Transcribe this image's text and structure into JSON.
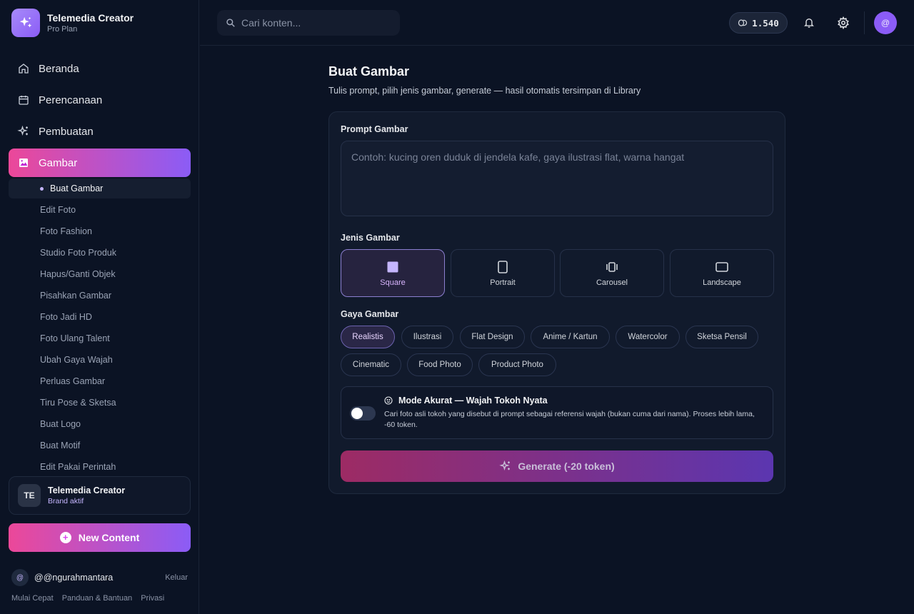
{
  "brand": {
    "title": "Telemedia Creator",
    "plan": "Pro Plan"
  },
  "nav": {
    "items": [
      {
        "label": "Beranda",
        "icon": "home-icon"
      },
      {
        "label": "Perencanaan",
        "icon": "calendar-icon"
      },
      {
        "label": "Pembuatan",
        "icon": "sparkles-icon"
      },
      {
        "label": "Gambar",
        "icon": "image-icon"
      }
    ],
    "sub_active": "Buat Gambar",
    "sub_items": [
      "Edit Foto",
      "Foto Fashion",
      "Studio Foto Produk",
      "Hapus/Ganti Objek",
      "Pisahkan Gambar",
      "Foto Jadi HD",
      "Foto Ulang Talent",
      "Ubah Gaya Wajah",
      "Perluas Gambar",
      "Tiru Pose & Sketsa",
      "Buat Logo",
      "Buat Motif",
      "Edit Pakai Perintah"
    ]
  },
  "brand_card": {
    "initials": "TE",
    "name": "Telemedia Creator",
    "status": "Brand aktif"
  },
  "new_content": {
    "label": "New Content"
  },
  "user": {
    "avatar": "@",
    "handle": "@@ngurahmantara",
    "logout": "Keluar"
  },
  "footer_links": [
    "Mulai Cepat",
    "Panduan & Bantuan",
    "Privasi"
  ],
  "topbar": {
    "search_placeholder": "Cari konten...",
    "tokens": "1.540",
    "avatar": "@"
  },
  "page": {
    "title": "Buat Gambar",
    "subtitle": "Tulis prompt, pilih jenis gambar, generate — hasil otomatis tersimpan di Library"
  },
  "form": {
    "prompt_label": "Prompt Gambar",
    "prompt_placeholder": "Contoh: kucing oren duduk di jendela kafe, gaya ilustrasi flat, warna hangat",
    "type_label": "Jenis Gambar",
    "types": [
      {
        "label": "Square",
        "icon": "square-icon",
        "selected": true
      },
      {
        "label": "Portrait",
        "icon": "portrait-icon",
        "selected": false
      },
      {
        "label": "Carousel",
        "icon": "carousel-icon",
        "selected": false
      },
      {
        "label": "Landscape",
        "icon": "landscape-icon",
        "selected": false
      }
    ],
    "style_label": "Gaya Gambar",
    "styles_row1": [
      "Realistis",
      "Ilustrasi",
      "Flat Design",
      "Anime / Kartun",
      "Watercolor",
      "Sketsa Pensil"
    ],
    "styles_row2": [
      "Cinematic",
      "Food Photo",
      "Product Photo"
    ],
    "selected_style": "Realistis",
    "mode_title": "Mode Akurat — Wajah Tokoh Nyata",
    "mode_desc": "Cari foto asli tokoh yang disebut di prompt sebagai referensi wajah (bukan cuma dari nama). Proses lebih lama, -60 token.",
    "mode_enabled": false,
    "generate_label": "Generate (-20 token)"
  },
  "colors": {
    "accent_pink": "#ec4899",
    "accent_purple": "#8b5cf6",
    "background": "#0b1324"
  }
}
